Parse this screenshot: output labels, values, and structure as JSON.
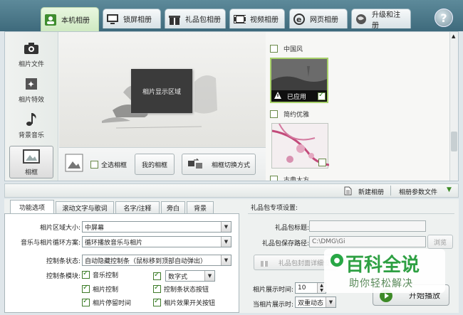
{
  "tabs": [
    {
      "label": "本机相册",
      "icon": "photo-album-icon",
      "active": true
    },
    {
      "label": "锁屏相册",
      "icon": "monitor-icon"
    },
    {
      "label": "礼品包相册",
      "icon": "gift-icon"
    },
    {
      "label": "视频相册",
      "icon": "film-icon"
    },
    {
      "label": "网页相册",
      "icon": "ie-browser-icon"
    },
    {
      "label": "升级和注册",
      "icon": "globe-icon"
    }
  ],
  "help_label": "?",
  "leftnav": [
    {
      "label": "相片文件",
      "icon": "camera-icon"
    },
    {
      "label": "相片特效",
      "icon": "sparkle-puzzle-icon"
    },
    {
      "label": "背景音乐",
      "icon": "music-note-icon"
    },
    {
      "label": "相框",
      "icon": "frame-icon",
      "active": true
    }
  ],
  "preview": {
    "placeholder": "相片显示区域"
  },
  "controls": {
    "select_all": "全选相框",
    "my_frames": "我的相框",
    "switch_mode": "相框切换方式"
  },
  "frames": {
    "cat1": "中国风",
    "applied": "已应用",
    "cat2": "简约优雅",
    "cat3": "古典大方"
  },
  "midbar": {
    "new_album": "新建相册",
    "params_file": "相册参数文件"
  },
  "bottom_tabs": [
    "功能选项",
    "滚动文字与歌词",
    "名字/注释",
    "旁白",
    "背景"
  ],
  "options": {
    "area_size_label": "相片区域大小:",
    "area_size_value": "中屏幕",
    "loop_label": "音乐与相片循环方案:",
    "loop_value": "循环播放音乐与相片",
    "ctrlbar_state_label": "控制条状态:",
    "ctrlbar_state_value": "自动隐藏控制条（鼠标移到顶部自动弹出）",
    "ctrlbar_module_label": "控制条模块:",
    "music_ctrl": "音乐控制",
    "digital_select": "数字式",
    "photo_ctrl": "相片控制",
    "ctrlbar_toggle": "控制条状态按钮",
    "photo_pause": "相片停留时间",
    "effect_toggle": "相片效果开关按钮"
  },
  "gift": {
    "title": "礼品包专项设置:",
    "gift_title_label": "礼品包标题:",
    "save_path_label": "礼品包保存路径:",
    "save_path_value": "C:\\DMG\\Gi",
    "browse": "浏览",
    "cover_btn": "礼品包封面详细设",
    "display_time_label": "相片展示时间:",
    "display_time_value": "10",
    "display_mode_label": "当相片展示时:",
    "display_mode_value": "双重动态",
    "play": "开始播放"
  },
  "watermark": {
    "title": "百科全说",
    "sub": "助你轻松解决"
  }
}
